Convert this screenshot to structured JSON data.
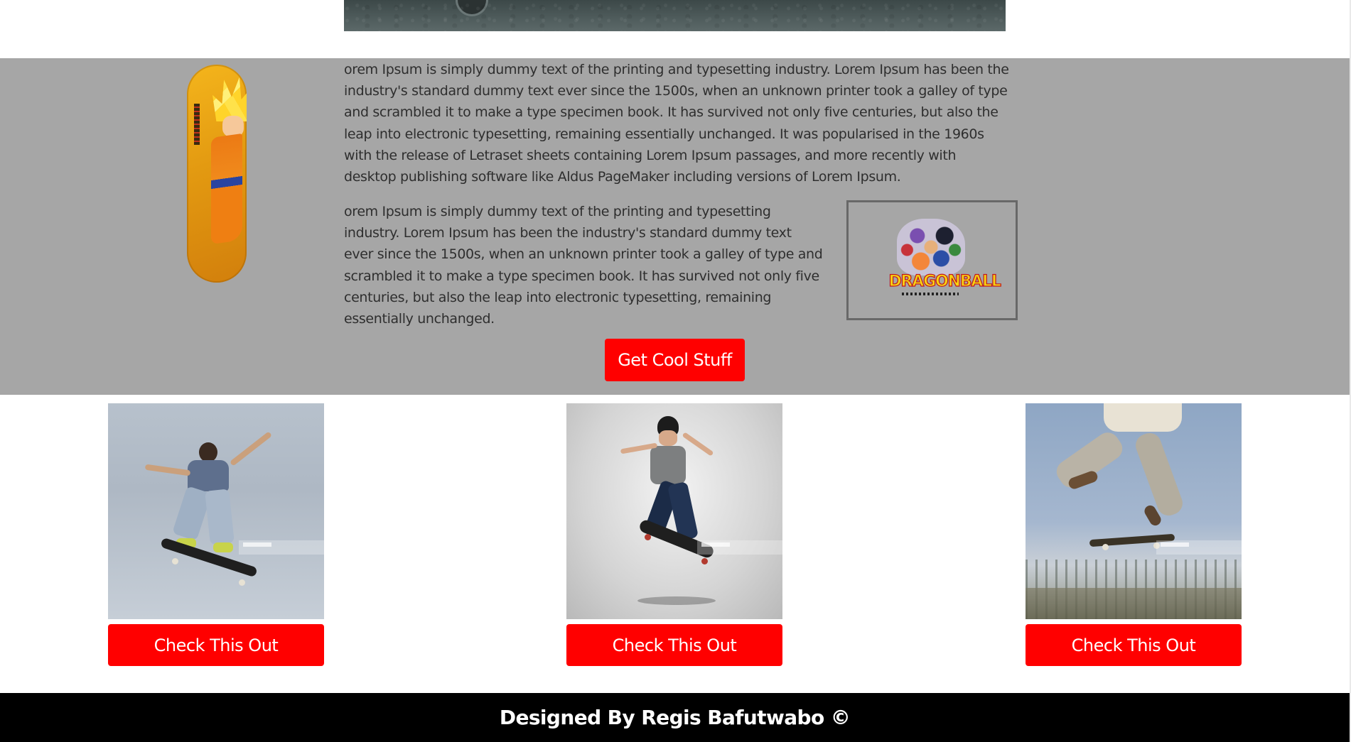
{
  "hero": {
    "image_name": "asphalt-banner"
  },
  "intro": {
    "paragraph_1": "orem Ipsum is simply dummy text of the printing and typesetting industry. Lorem Ipsum has been the industry's standard dummy text ever since the 1500s, when an unknown printer took a galley of type and scrambled it to make a type specimen book. It has survived not only five centuries, but also the leap into electronic typesetting, remaining essentially unchanged. It was popularised in the 1960s with the release of Letraset sheets containing Lorem Ipsum passages, and more recently with desktop publishing software like Aldus PageMaker including versions of Lorem Ipsum.",
    "paragraph_2": "orem Ipsum is simply dummy text of the printing and typesetting industry. Lorem Ipsum has been the industry's standard dummy text ever since the 1500s, when an unknown printer took a galley of type and scrambled it to make a type specimen book. It has survived not only five centuries, but also the leap into electronic typesetting, remaining essentially unchanged.",
    "cta_label": "Get Cool Stuff",
    "logo_text": "DRAGONBALL"
  },
  "products": [
    {
      "image": "skater-jump-sky",
      "button_label": "Check This Out"
    },
    {
      "image": "skater-studio-flip",
      "button_label": "Check This Out"
    },
    {
      "image": "skater-legs-ollie",
      "button_label": "Check This Out"
    }
  ],
  "footer": {
    "credit": "Designed By Regis Bafutwabo ©"
  },
  "colors": {
    "band": "#a6a6a6",
    "button": "#ff0000",
    "footer": "#000000",
    "text": "#2e2e2e"
  }
}
